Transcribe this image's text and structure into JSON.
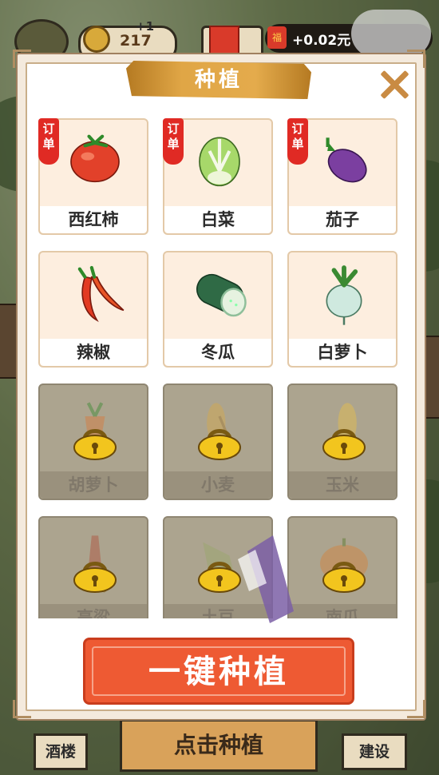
{
  "hud": {
    "coins": "217",
    "coins_delta": "+1",
    "reward_amount": "+0.02元",
    "reward_icon": "福"
  },
  "dialog": {
    "title": "种植",
    "order_tag": "订单",
    "crops": [
      {
        "name": "西红柿",
        "icon": "tomato-icon",
        "locked": false,
        "order": true
      },
      {
        "name": "白菜",
        "icon": "cabbage-icon",
        "locked": false,
        "order": true
      },
      {
        "name": "茄子",
        "icon": "eggplant-icon",
        "locked": false,
        "order": true
      },
      {
        "name": "辣椒",
        "icon": "chili-icon",
        "locked": false,
        "order": false
      },
      {
        "name": "冬瓜",
        "icon": "winter-melon-icon",
        "locked": false,
        "order": false
      },
      {
        "name": "白萝卜",
        "icon": "radish-icon",
        "locked": false,
        "order": false
      },
      {
        "name": "胡萝卜",
        "icon": "carrot-icon",
        "locked": true,
        "order": false
      },
      {
        "name": "小麦",
        "icon": "wheat-icon",
        "locked": true,
        "order": false
      },
      {
        "name": "玉米",
        "icon": "corn-icon",
        "locked": true,
        "order": false
      },
      {
        "name": "高粱",
        "icon": "sorghum-icon",
        "locked": true,
        "order": false
      },
      {
        "name": "土豆",
        "icon": "potato-icon",
        "locked": true,
        "order": false
      },
      {
        "name": "南瓜",
        "icon": "pumpkin-icon",
        "locked": true,
        "order": false
      }
    ],
    "plant_all_label": "一键种植"
  },
  "bottom_bar": {
    "left_label": "酒楼",
    "center_label": "点击种植",
    "right_label": "建设"
  },
  "colors": {
    "accent_red": "#ee5a33",
    "title_gold": "#e0a646",
    "card_bg": "#fdeedf",
    "locked_bg": "#aca48f"
  }
}
